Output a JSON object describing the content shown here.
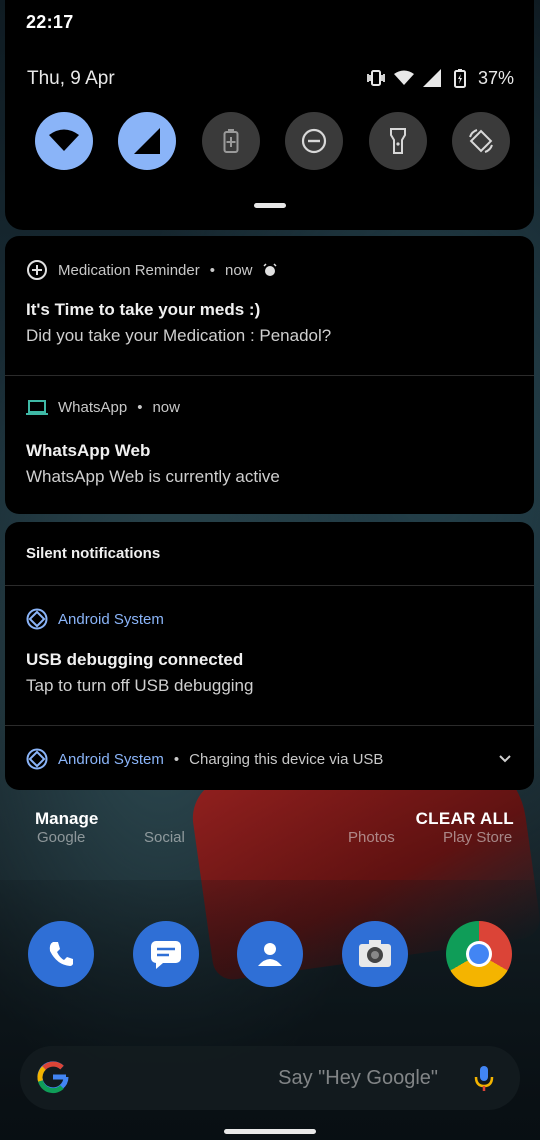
{
  "status_bar": {
    "time": "22:17"
  },
  "quick_settings": {
    "date": "Thu, 9 Apr",
    "battery_percent": "37%",
    "status_icons": [
      "vibrate-icon",
      "wifi-icon",
      "signal-icon",
      "battery-charging-icon"
    ],
    "tiles": [
      {
        "name": "wifi-tile",
        "icon": "wifi-icon",
        "active": true
      },
      {
        "name": "mobile-data-tile",
        "icon": "signal-icon",
        "active": true
      },
      {
        "name": "battery-saver-tile",
        "icon": "battery-saver-icon",
        "active": false
      },
      {
        "name": "do-not-disturb-tile",
        "icon": "do-not-disturb-icon",
        "active": false
      },
      {
        "name": "flashlight-tile",
        "icon": "flashlight-icon",
        "active": false
      },
      {
        "name": "auto-rotate-tile",
        "icon": "auto-rotate-icon",
        "active": false
      }
    ],
    "accent_color": "#8ab4f8"
  },
  "notifications": [
    {
      "app": "Medication Reminder",
      "time": "now",
      "title": "It's Time to take your meds :)",
      "text": "Did you take your Medication : Penadol?",
      "icon": "add-circle-icon",
      "extra_icon": "alarm-icon"
    },
    {
      "app": "WhatsApp",
      "time": "now",
      "title": "WhatsApp Web",
      "text": "WhatsApp Web is currently active",
      "icon": "laptop-icon"
    }
  ],
  "silent": {
    "section_title": "Silent notifications",
    "items": [
      {
        "app": "Android System",
        "title": "USB debugging connected",
        "text": "Tap to turn off USB debugging",
        "icon": "android-system-icon"
      },
      {
        "app": "Android System",
        "summary": "Charging this device via USB",
        "icon": "android-system-icon"
      }
    ]
  },
  "actions": {
    "manage": "Manage",
    "clear_all": "CLEAR ALL"
  },
  "home_screen": {
    "folders": [
      "Google",
      "Social",
      "Photos",
      "Play Store"
    ],
    "dock": [
      "phone-icon",
      "messages-icon",
      "contacts-icon",
      "camera-icon",
      "chrome-icon"
    ],
    "search_hint": "Say \"Hey Google\""
  }
}
